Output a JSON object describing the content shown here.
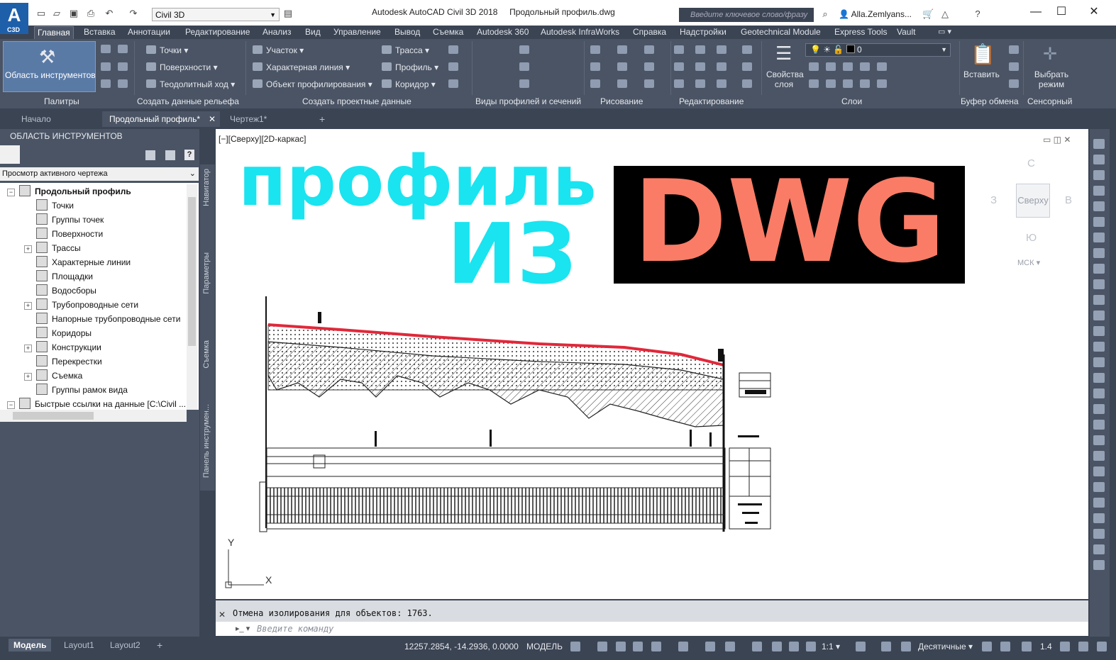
{
  "app": {
    "logo": "A",
    "logo_sub": "C3D",
    "workspace": "Civil 3D",
    "title": "Autodesk AutoCAD Civil 3D 2018     Продольный профиль.dwg",
    "search_placeholder": "Введите ключевое слово/фразу",
    "user": "Alla.Zemlyans..."
  },
  "menu": [
    "Главная",
    "Вставка",
    "Аннотации",
    "Редактирование",
    "Анализ",
    "Вид",
    "Управление",
    "Вывод",
    "Съемка",
    "Autodesk 360",
    "Autodesk InfraWorks",
    "Справка",
    "Надстройки",
    "Geotechnical Module",
    "Express Tools",
    "Vault"
  ],
  "ribbon": {
    "tools_palette": "Область инструментов",
    "points": "Точки",
    "surfaces": "Поверхности",
    "traverse": "Теодолитный ход",
    "parcel": "Участок",
    "feature_line": "Характерная линия",
    "grading": "Объект профилирования",
    "alignment": "Трасса",
    "profile": "Профиль",
    "corridor": "Коридор",
    "layer_props_1": "Свойства",
    "layer_props_2": "слоя",
    "layer_value": "0",
    "paste": "Вставить",
    "select_mode_1": "Выбрать",
    "select_mode_2": "режим",
    "panels": [
      "Палитры",
      "Создать данные рельефа",
      "Создать проектные данные",
      "Виды профилей и сечений",
      "Рисование",
      "Редактирование",
      "Слои",
      "Буфер обмена",
      "Сенсорный"
    ]
  },
  "file_tabs": [
    "Начало",
    "Продольный профиль*",
    "Чертеж1*"
  ],
  "palette": {
    "title": "ОБЛАСТЬ ИНСТРУМЕНТОВ",
    "view": "Просмотр активного чертежа",
    "tree": [
      {
        "label": "Продольный профиль",
        "level": 0,
        "expander": "−",
        "bold": true
      },
      {
        "label": "Точки",
        "level": 1,
        "expander": ""
      },
      {
        "label": "Группы точек",
        "level": 1,
        "expander": ""
      },
      {
        "label": "Поверхности",
        "level": 1,
        "expander": ""
      },
      {
        "label": "Трассы",
        "level": 1,
        "expander": "+"
      },
      {
        "label": "Характерные линии",
        "level": 1,
        "expander": ""
      },
      {
        "label": "Площадки",
        "level": 1,
        "expander": ""
      },
      {
        "label": "Водосборы",
        "level": 1,
        "expander": ""
      },
      {
        "label": "Трубопроводные сети",
        "level": 1,
        "expander": "+"
      },
      {
        "label": "Напорные трубопроводные сети",
        "level": 1,
        "expander": ""
      },
      {
        "label": "Коридоры",
        "level": 1,
        "expander": ""
      },
      {
        "label": "Конструкции",
        "level": 1,
        "expander": "+"
      },
      {
        "label": "Перекрестки",
        "level": 1,
        "expander": ""
      },
      {
        "label": "Съемка",
        "level": 1,
        "expander": "+"
      },
      {
        "label": "Группы рамок вида",
        "level": 1,
        "expander": ""
      },
      {
        "label": "Быстрые ссылки на данные [C:\\Civil ...",
        "level": 0,
        "expander": "−"
      }
    ],
    "side_tabs": [
      "Навигатор",
      "Параметры",
      "Съемка",
      "Панель инструмен..."
    ]
  },
  "viewport": {
    "label": "[−][Сверху][2D-каркас]",
    "overlay_line1": "профиль",
    "overlay_line2": "ИЗ",
    "overlay_dwg": "DWG",
    "viewcube": {
      "n": "С",
      "w": "З",
      "e": "В",
      "s": "Ю",
      "face": "Сверху",
      "ucs": "МСК"
    },
    "axis_y": "Y",
    "axis_x": "X"
  },
  "command": {
    "history": "Отмена изолирования для объектов: 1763.",
    "placeholder": "Введите команду"
  },
  "status": {
    "layout_tabs": [
      "Модель",
      "Layout1",
      "Layout2"
    ],
    "coords": "12257.2854, -14.2936, 0.0000",
    "space": "МОДЕЛЬ",
    "scale": "1:1",
    "units": "Десятичные",
    "zoom": "1.4"
  },
  "colors": {
    "accent": "#19e4f0",
    "dwg": "#fa7c66",
    "ribbon": "#4a5464",
    "dark": "#3b4453"
  }
}
